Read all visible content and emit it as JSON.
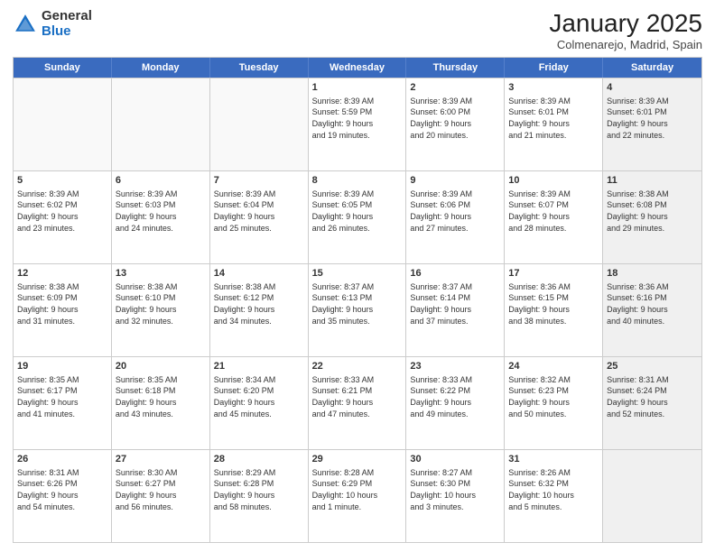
{
  "logo": {
    "general": "General",
    "blue": "Blue"
  },
  "title": "January 2025",
  "location": "Colmenarejo, Madrid, Spain",
  "weekdays": [
    "Sunday",
    "Monday",
    "Tuesday",
    "Wednesday",
    "Thursday",
    "Friday",
    "Saturday"
  ],
  "rows": [
    [
      {
        "day": "",
        "text": "",
        "empty": true
      },
      {
        "day": "",
        "text": "",
        "empty": true
      },
      {
        "day": "",
        "text": "",
        "empty": true
      },
      {
        "day": "1",
        "text": "Sunrise: 8:39 AM\nSunset: 5:59 PM\nDaylight: 9 hours\nand 19 minutes."
      },
      {
        "day": "2",
        "text": "Sunrise: 8:39 AM\nSunset: 6:00 PM\nDaylight: 9 hours\nand 20 minutes."
      },
      {
        "day": "3",
        "text": "Sunrise: 8:39 AM\nSunset: 6:01 PM\nDaylight: 9 hours\nand 21 minutes."
      },
      {
        "day": "4",
        "text": "Sunrise: 8:39 AM\nSunset: 6:01 PM\nDaylight: 9 hours\nand 22 minutes.",
        "shaded": true
      }
    ],
    [
      {
        "day": "5",
        "text": "Sunrise: 8:39 AM\nSunset: 6:02 PM\nDaylight: 9 hours\nand 23 minutes."
      },
      {
        "day": "6",
        "text": "Sunrise: 8:39 AM\nSunset: 6:03 PM\nDaylight: 9 hours\nand 24 minutes."
      },
      {
        "day": "7",
        "text": "Sunrise: 8:39 AM\nSunset: 6:04 PM\nDaylight: 9 hours\nand 25 minutes."
      },
      {
        "day": "8",
        "text": "Sunrise: 8:39 AM\nSunset: 6:05 PM\nDaylight: 9 hours\nand 26 minutes."
      },
      {
        "day": "9",
        "text": "Sunrise: 8:39 AM\nSunset: 6:06 PM\nDaylight: 9 hours\nand 27 minutes."
      },
      {
        "day": "10",
        "text": "Sunrise: 8:39 AM\nSunset: 6:07 PM\nDaylight: 9 hours\nand 28 minutes."
      },
      {
        "day": "11",
        "text": "Sunrise: 8:38 AM\nSunset: 6:08 PM\nDaylight: 9 hours\nand 29 minutes.",
        "shaded": true
      }
    ],
    [
      {
        "day": "12",
        "text": "Sunrise: 8:38 AM\nSunset: 6:09 PM\nDaylight: 9 hours\nand 31 minutes."
      },
      {
        "day": "13",
        "text": "Sunrise: 8:38 AM\nSunset: 6:10 PM\nDaylight: 9 hours\nand 32 minutes."
      },
      {
        "day": "14",
        "text": "Sunrise: 8:38 AM\nSunset: 6:12 PM\nDaylight: 9 hours\nand 34 minutes."
      },
      {
        "day": "15",
        "text": "Sunrise: 8:37 AM\nSunset: 6:13 PM\nDaylight: 9 hours\nand 35 minutes."
      },
      {
        "day": "16",
        "text": "Sunrise: 8:37 AM\nSunset: 6:14 PM\nDaylight: 9 hours\nand 37 minutes."
      },
      {
        "day": "17",
        "text": "Sunrise: 8:36 AM\nSunset: 6:15 PM\nDaylight: 9 hours\nand 38 minutes."
      },
      {
        "day": "18",
        "text": "Sunrise: 8:36 AM\nSunset: 6:16 PM\nDaylight: 9 hours\nand 40 minutes.",
        "shaded": true
      }
    ],
    [
      {
        "day": "19",
        "text": "Sunrise: 8:35 AM\nSunset: 6:17 PM\nDaylight: 9 hours\nand 41 minutes."
      },
      {
        "day": "20",
        "text": "Sunrise: 8:35 AM\nSunset: 6:18 PM\nDaylight: 9 hours\nand 43 minutes."
      },
      {
        "day": "21",
        "text": "Sunrise: 8:34 AM\nSunset: 6:20 PM\nDaylight: 9 hours\nand 45 minutes."
      },
      {
        "day": "22",
        "text": "Sunrise: 8:33 AM\nSunset: 6:21 PM\nDaylight: 9 hours\nand 47 minutes."
      },
      {
        "day": "23",
        "text": "Sunrise: 8:33 AM\nSunset: 6:22 PM\nDaylight: 9 hours\nand 49 minutes."
      },
      {
        "day": "24",
        "text": "Sunrise: 8:32 AM\nSunset: 6:23 PM\nDaylight: 9 hours\nand 50 minutes."
      },
      {
        "day": "25",
        "text": "Sunrise: 8:31 AM\nSunset: 6:24 PM\nDaylight: 9 hours\nand 52 minutes.",
        "shaded": true
      }
    ],
    [
      {
        "day": "26",
        "text": "Sunrise: 8:31 AM\nSunset: 6:26 PM\nDaylight: 9 hours\nand 54 minutes."
      },
      {
        "day": "27",
        "text": "Sunrise: 8:30 AM\nSunset: 6:27 PM\nDaylight: 9 hours\nand 56 minutes."
      },
      {
        "day": "28",
        "text": "Sunrise: 8:29 AM\nSunset: 6:28 PM\nDaylight: 9 hours\nand 58 minutes."
      },
      {
        "day": "29",
        "text": "Sunrise: 8:28 AM\nSunset: 6:29 PM\nDaylight: 10 hours\nand 1 minute."
      },
      {
        "day": "30",
        "text": "Sunrise: 8:27 AM\nSunset: 6:30 PM\nDaylight: 10 hours\nand 3 minutes."
      },
      {
        "day": "31",
        "text": "Sunrise: 8:26 AM\nSunset: 6:32 PM\nDaylight: 10 hours\nand 5 minutes."
      },
      {
        "day": "",
        "text": "",
        "empty": true,
        "shaded": true
      }
    ]
  ]
}
